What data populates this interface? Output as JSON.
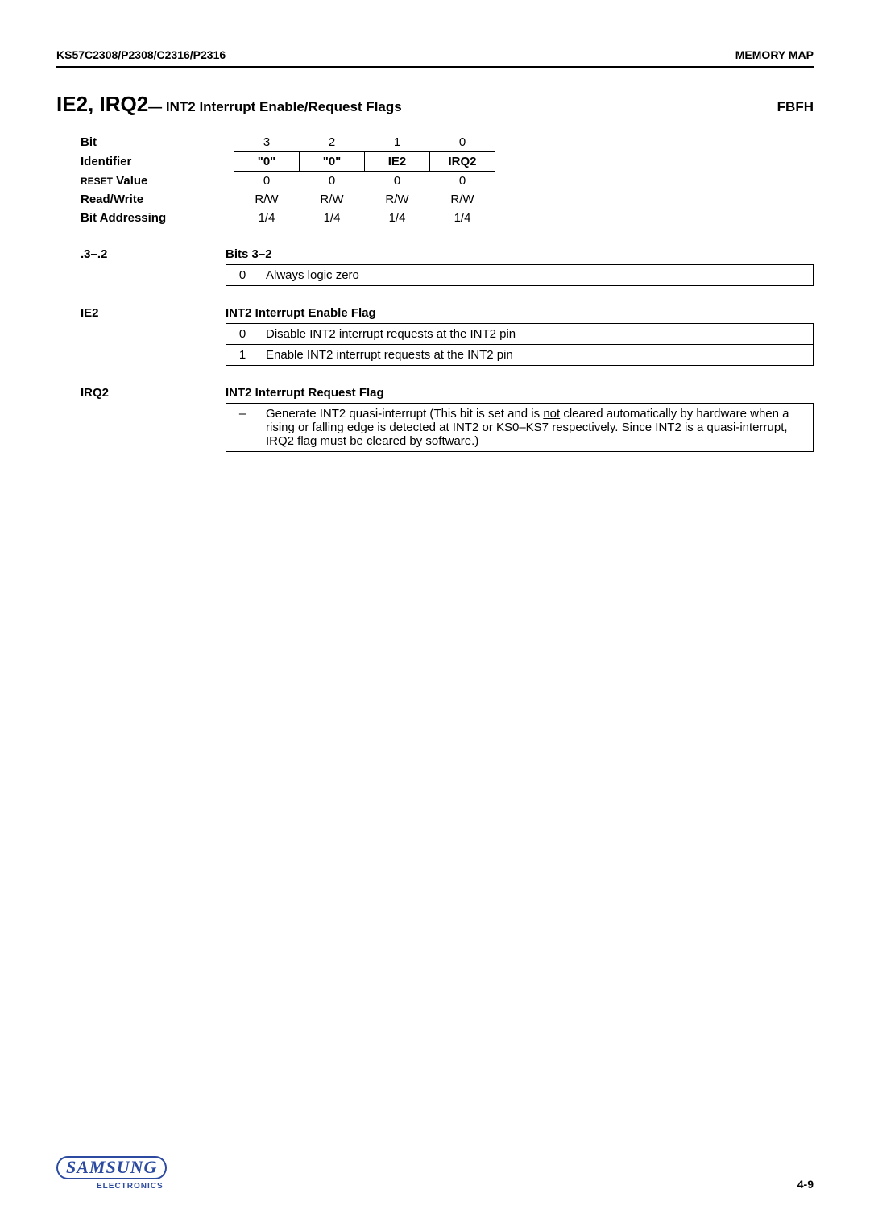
{
  "header": {
    "left": "KS57C2308/P2308/C2316/P2316",
    "right": "MEMORY MAP"
  },
  "title": {
    "main": "IE2, IRQ2",
    "sub": " — INT2 Interrupt Enable/Request Flags",
    "addr": "FBFH"
  },
  "bit_table": {
    "rows": {
      "bit": {
        "label": "Bit",
        "c3": "3",
        "c2": "2",
        "c1": "1",
        "c0": "0"
      },
      "identifier": {
        "label": "Identifier",
        "c3": "\"0\"",
        "c2": "\"0\"",
        "c1": "IE2",
        "c0": "IRQ2"
      },
      "reset": {
        "label_prefix": "RESET",
        "label_suffix": " Value",
        "c3": "0",
        "c2": "0",
        "c1": "0",
        "c0": "0"
      },
      "rw": {
        "label": "Read/Write",
        "c3": "R/W",
        "c2": "R/W",
        "c1": "R/W",
        "c0": "R/W"
      },
      "addr": {
        "label": "Bit Addressing",
        "c3": "1/4",
        "c2": "1/4",
        "c1": "1/4",
        "c0": "1/4"
      }
    }
  },
  "sections": {
    "bits32": {
      "label": ".3–.2",
      "title": "Bits 3–2",
      "rows": [
        {
          "code": "0",
          "desc": "Always logic zero"
        }
      ]
    },
    "ie2": {
      "label": "IE2",
      "title": "INT2 Interrupt Enable Flag",
      "rows": [
        {
          "code": "0",
          "desc": "Disable INT2 interrupt requests at the INT2 pin"
        },
        {
          "code": "1",
          "desc": "Enable INT2 interrupt requests at the INT2 pin"
        }
      ]
    },
    "irq2": {
      "label": "IRQ2",
      "title": "INT2 Interrupt Request Flag",
      "rows": [
        {
          "code": "–",
          "desc_pre": "Generate INT2 quasi-interrupt (This bit is set and is ",
          "desc_not": "not",
          "desc_post": " cleared automatically by hardware when a rising or falling edge is detected at INT2 or KS0–KS7 respectively. Since INT2 is a quasi-interrupt, IRQ2 flag must be cleared by software.)"
        }
      ]
    }
  },
  "footer": {
    "logo": "SAMSUNG",
    "sub": "ELECTRONICS",
    "page": "4-9"
  }
}
